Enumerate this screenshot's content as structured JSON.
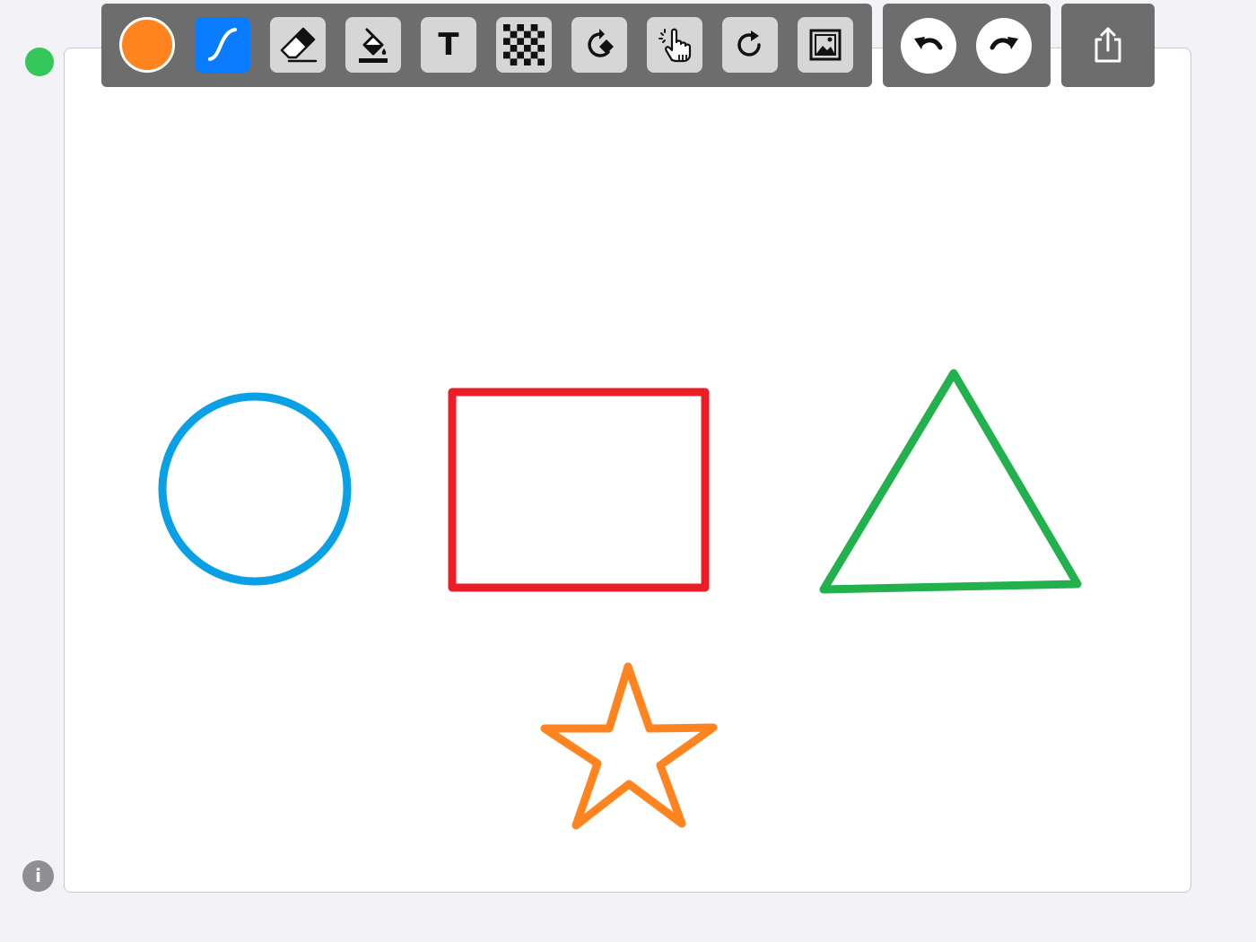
{
  "toolbar": {
    "current_color": "#ff8420",
    "text_tool_label": "T",
    "tools": [
      {
        "name": "pen",
        "icon": "pen-stroke-icon",
        "active": true
      },
      {
        "name": "eraser",
        "icon": "eraser-icon",
        "active": false
      },
      {
        "name": "fill",
        "icon": "paint-bucket-icon",
        "active": false
      },
      {
        "name": "text",
        "icon": "text-icon",
        "active": false
      },
      {
        "name": "background",
        "icon": "checkerboard-icon",
        "active": false
      },
      {
        "name": "rotate",
        "icon": "rotate-shape-icon",
        "active": false
      },
      {
        "name": "gesture",
        "icon": "hand-gesture-icon",
        "active": false
      },
      {
        "name": "redo-rotate",
        "icon": "refresh-icon",
        "active": false
      },
      {
        "name": "image",
        "icon": "image-icon",
        "active": false
      }
    ]
  },
  "history": {
    "undo_icon": "undo-icon",
    "redo_icon": "redo-icon"
  },
  "share": {
    "icon": "share-icon"
  },
  "status": {
    "color": "#34c759"
  },
  "info": {
    "label": "i"
  },
  "drawing": {
    "shapes": [
      {
        "type": "circle",
        "color": "#0aa0e6"
      },
      {
        "type": "rectangle",
        "color": "#ec1d27"
      },
      {
        "type": "triangle",
        "color": "#22b14c"
      },
      {
        "type": "star",
        "color": "#ff8420"
      }
    ]
  }
}
